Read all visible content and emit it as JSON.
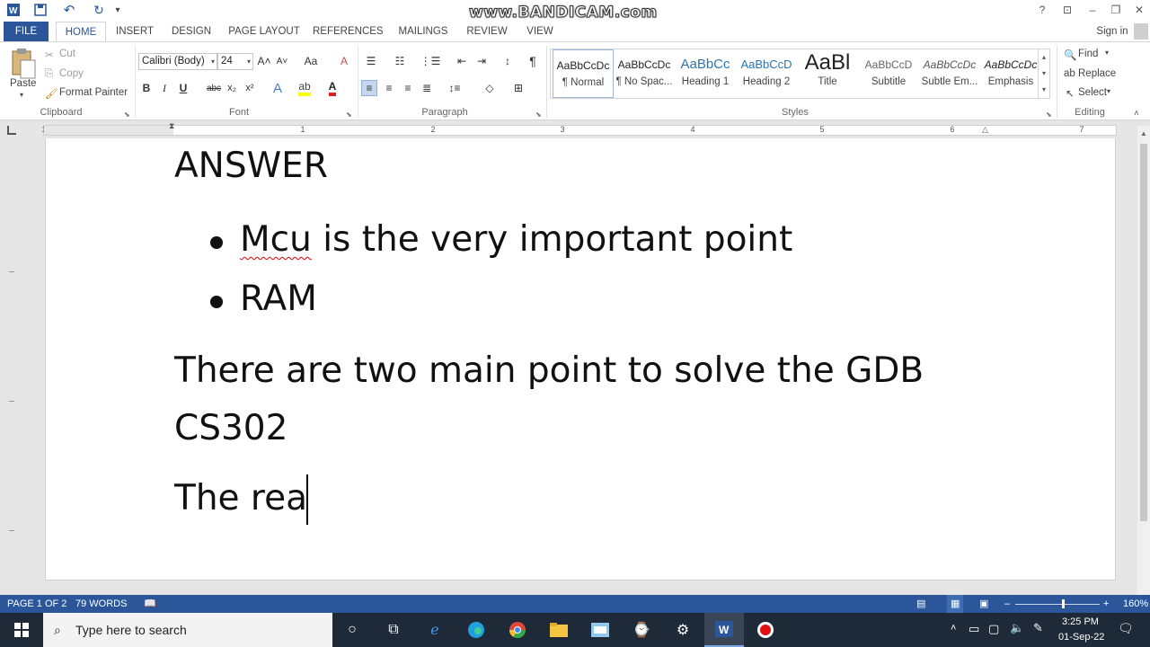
{
  "titlebar": {
    "watermark": "www.BANDICAM.com",
    "help": "?",
    "ribbon_options": "⊡",
    "minimize": "–",
    "restore": "❐",
    "close": "✕",
    "qat": {
      "save": "💾",
      "undo": "↶",
      "redo": "↻",
      "customize": "₹"
    }
  },
  "tabs": [
    "FILE",
    "HOME",
    "INSERT",
    "DESIGN",
    "PAGE LAYOUT",
    "REFERENCES",
    "MAILINGS",
    "REVIEW",
    "VIEW"
  ],
  "signin": "Sign in",
  "clipboard": {
    "paste": "Paste",
    "cut": "Cut",
    "copy": "Copy",
    "format_painter": "Format Painter",
    "group_label": "Clipboard"
  },
  "font": {
    "name": "Calibri (Body)",
    "size": "24",
    "group_label": "Font",
    "bold": "B",
    "italic": "I",
    "underline": "U",
    "strike": "abc",
    "subscript": "x₂",
    "superscript": "x²",
    "grow": "A˄",
    "shrink": "A˅",
    "case": "Aa",
    "clear": "A"
  },
  "paragraph": {
    "group_label": "Paragraph",
    "pilcrow": "¶"
  },
  "styles": {
    "group_label": "Styles",
    "items": [
      {
        "preview": "AaBbCcDc",
        "name": "¶ Normal"
      },
      {
        "preview": "AaBbCcDc",
        "name": "¶ No Spac..."
      },
      {
        "preview": "AaBbCc",
        "name": "Heading 1"
      },
      {
        "preview": "AaBbCcD",
        "name": "Heading 2"
      },
      {
        "preview": "AaBl",
        "name": "Title"
      },
      {
        "preview": "AaBbCcD",
        "name": "Subtitle"
      },
      {
        "preview": "AaBbCcDc",
        "name": "Subtle Em..."
      },
      {
        "preview": "AaBbCcDc",
        "name": "Emphasis"
      }
    ]
  },
  "editing": {
    "find": "Find",
    "replace": "Replace",
    "select": "Select",
    "group_label": "Editing"
  },
  "ruler": {
    "numbers": [
      "1",
      "1",
      "2",
      "3",
      "4",
      "5",
      "6",
      "7"
    ]
  },
  "document": {
    "heading": "ANSWER",
    "bullets": [
      {
        "misspelled": "Mcu",
        "rest": " is the very important point"
      },
      {
        "misspelled": "",
        "rest": "RAM"
      }
    ],
    "line1": "There are two main point to solve the GDB",
    "line2": "CS302",
    "line3": "The rea"
  },
  "statusbar": {
    "page": "PAGE 1 OF 2",
    "words": "79 WORDS",
    "zoom": "160%",
    "minus": "–",
    "plus": "+"
  },
  "taskbar": {
    "search_placeholder": "Type here to search",
    "time": "3:25 PM",
    "date": "01-Sep-22"
  },
  "colors": {
    "word_blue": "#2b579a",
    "taskbar": "#1f2a38",
    "spell_red": "#dd0000"
  }
}
